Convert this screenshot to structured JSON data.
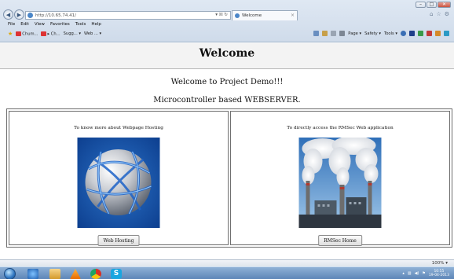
{
  "browser": {
    "window_controls": {
      "minimize": "–",
      "maximize": "□",
      "close": "✕"
    },
    "nav": {
      "back_icon": "back-arrow-icon",
      "forward_icon": "forward-arrow-icon"
    },
    "address": {
      "url": "http://10.65.74.41/",
      "tools": "▾ ☒ ↻"
    },
    "tab": {
      "label": "Welcome",
      "close": "×"
    },
    "right_icons": [
      "home-icon",
      "star-icon",
      "gear-icon"
    ],
    "menu": [
      "File",
      "Edit",
      "View",
      "Favorites",
      "Tools",
      "Help"
    ],
    "favorites": [
      {
        "label": "Chum..."
      },
      {
        "label": "▸ Ch..."
      },
      {
        "label": "Sugg... ▾"
      },
      {
        "label": "Web ... ▾"
      }
    ],
    "command_bar": [
      "Page ▾",
      "Safety ▾",
      "Tools ▾"
    ]
  },
  "page": {
    "title": "Welcome",
    "welcome_line": "Welcome to Project Demo!!!",
    "subtitle": "Microcontroller based WEBSERVER.",
    "panels": [
      {
        "caption": "To know more about Webpage Hosting",
        "button": "Web Hosting",
        "image": "globe-network-image"
      },
      {
        "caption": "To directly access the RMSec Web application",
        "button": "RMSec Home",
        "image": "power-plant-image"
      }
    ]
  },
  "statusbar": {
    "zoom": "100%  ▾"
  },
  "taskbar": {
    "tray_time": "10:55",
    "tray_date": "19-04-2013"
  }
}
